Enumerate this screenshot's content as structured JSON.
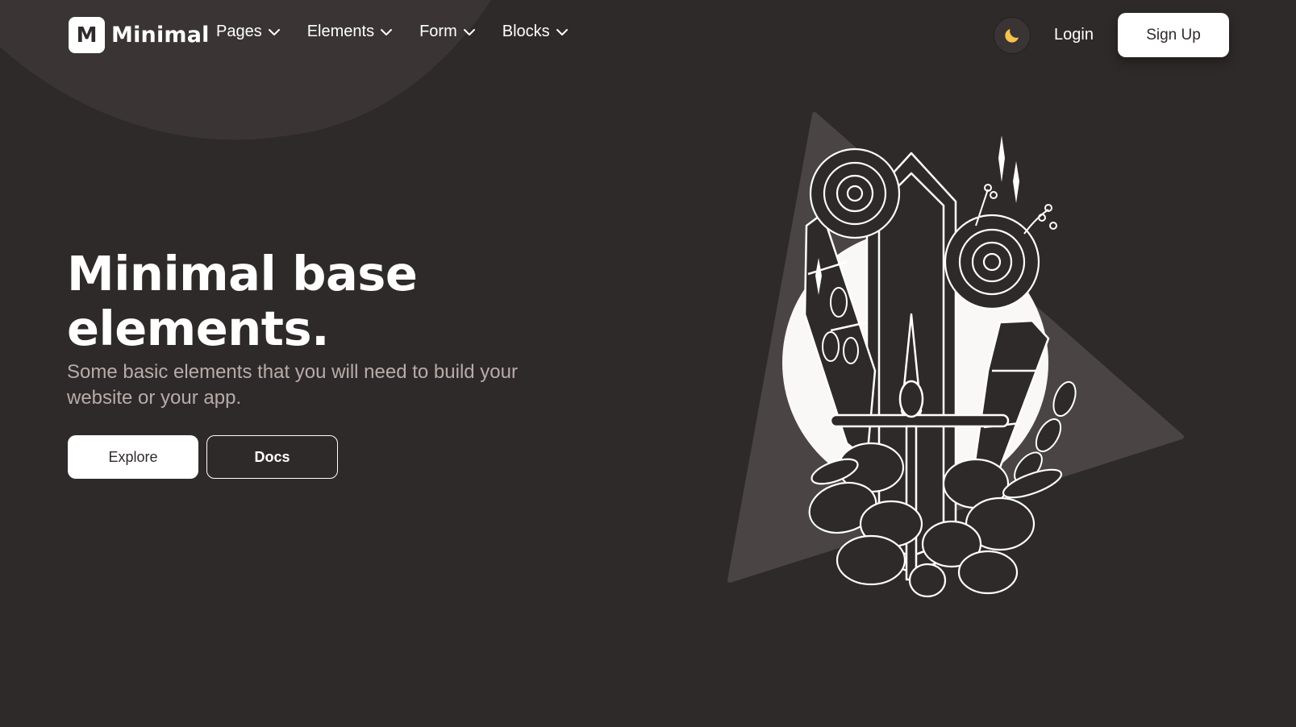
{
  "brand": {
    "logo_letter": "M",
    "name": "Minimal"
  },
  "nav": {
    "items": [
      {
        "label": "Pages"
      },
      {
        "label": "Elements"
      },
      {
        "label": "Form"
      },
      {
        "label": "Blocks"
      }
    ]
  },
  "header": {
    "theme_icon": "moon-icon",
    "login_label": "Login",
    "signup_label": "Sign Up"
  },
  "hero": {
    "title": "Minimal base elements.",
    "subtitle": "Some basic elements that you will need to build your website or your app.",
    "explore_label": "Explore",
    "docs_label": "Docs",
    "illustration": "crystal-flowers-illustration"
  },
  "colors": {
    "background": "#2f2a2a",
    "surface": "#3a3434",
    "text": "#ffffff",
    "muted_text": "#b7aca8",
    "moon": "#f5c24b"
  }
}
